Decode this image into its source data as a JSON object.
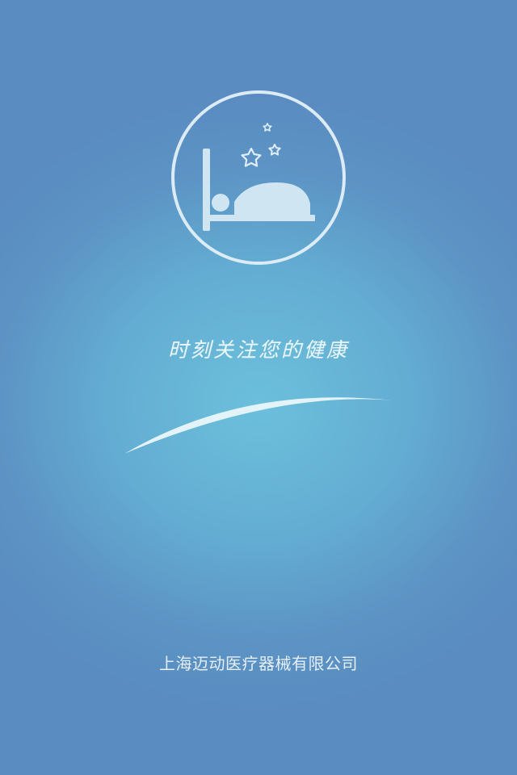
{
  "splash": {
    "logo_icon": "sleeping-person-bed-icon",
    "slogan": "时刻关注您的健康",
    "company_name": "上海迈动医疗器械有限公司"
  },
  "colors": {
    "background_center": "#6cc0dc",
    "background_edge": "#5a8cc1",
    "foreground": "#ddeef7"
  }
}
